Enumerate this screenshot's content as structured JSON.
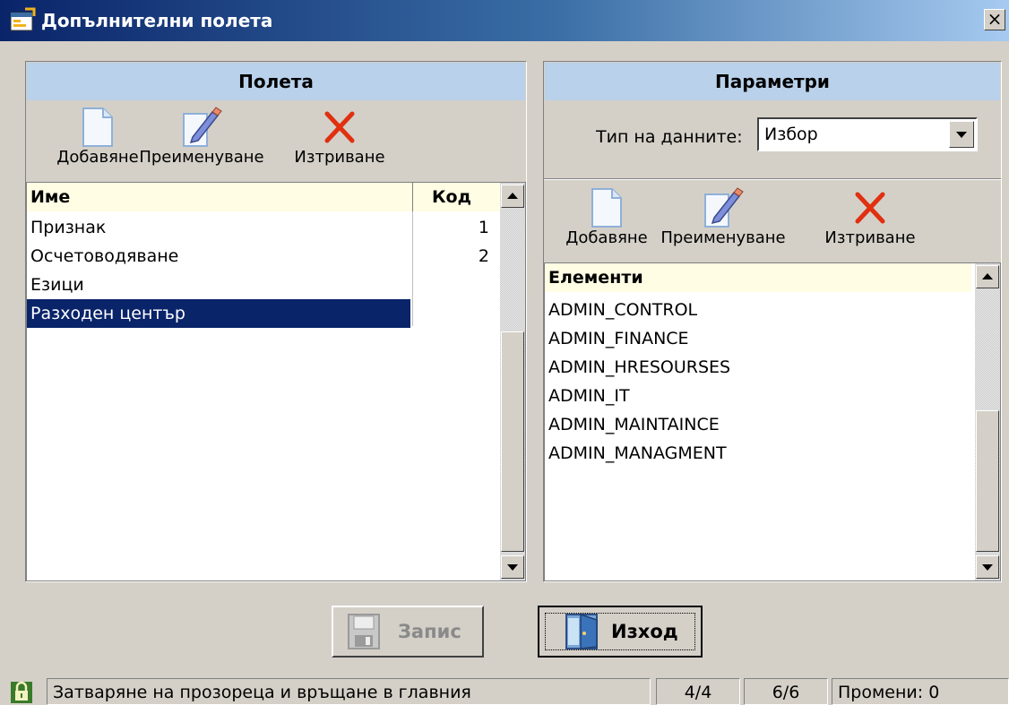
{
  "window": {
    "title": "Допълнителни полета",
    "close_glyph": "×"
  },
  "fields_panel": {
    "header": "Полета",
    "toolbar": {
      "add": "Добавяне",
      "rename": "Преименуване",
      "delete": "Изтриване"
    },
    "columns": {
      "name": "Име",
      "code": "Код"
    },
    "rows": [
      {
        "name": "Признак",
        "code": "1"
      },
      {
        "name": "Осчетоводяване",
        "code": "2"
      },
      {
        "name": "Езици",
        "code": ""
      },
      {
        "name": "Разходен център",
        "code": ""
      }
    ],
    "selected_row": 3
  },
  "params_panel": {
    "header": "Параметри",
    "data_type_label": "Тип на данните:",
    "data_type_value": "Избор",
    "toolbar": {
      "add": "Добавяне",
      "rename": "Преименуване",
      "delete": "Изтриване"
    },
    "elements_header": "Елементи",
    "elements": [
      "ADMIN_CONTROL",
      "ADMIN_FINANCE",
      "ADMIN_HRESOURSES",
      "ADMIN_IT",
      "ADMIN_MAINTAINCE",
      "ADMIN_MANAGMENT"
    ]
  },
  "buttons": {
    "save": "Запис",
    "exit": "Изход"
  },
  "statusbar": {
    "message": "Затваряне на прозореца и връщане в главния",
    "records": "4/4",
    "elements": "6/6",
    "changes": "Промени: 0"
  },
  "icons": {
    "app": "window-icon",
    "new": "new-document-icon",
    "rename": "pencil-edit-icon",
    "delete": "red-x-icon",
    "save": "floppy-disk-icon",
    "exit": "exit-door-icon",
    "lock": "padlock-icon",
    "scroll_up": "arrow-up-icon",
    "scroll_down": "arrow-down-icon",
    "dropdown": "arrow-down-icon"
  },
  "colors": {
    "selection": "#0a246a",
    "panel_header": "#b9d1ea",
    "grid_header": "#fffde3",
    "delete": "#e03010"
  }
}
